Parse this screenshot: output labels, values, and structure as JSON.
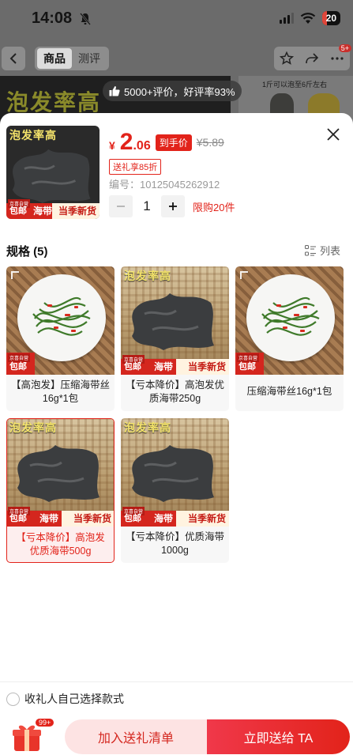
{
  "status_bar": {
    "time": "14:08",
    "battery": "20"
  },
  "nav": {
    "tabs": [
      {
        "label": "商品",
        "active": true
      },
      {
        "label": "测评",
        "active": false
      }
    ],
    "more_badge": "5+"
  },
  "hero": {
    "left_text": "泡发率高",
    "right_text": "1斤可以泡至6斤左右"
  },
  "reviews_pill": "5000+评价，好评率93%",
  "product": {
    "thumb_title": "泡发率高",
    "price_symbol": "¥",
    "price_int": "2",
    "price_dec": ".06",
    "price_tag": "到手价",
    "price_original": "¥5.89",
    "gift_discount": "送礼享85折",
    "sku_label": "编号：10125045262912",
    "quantity": "1",
    "limit_text": "限购20件"
  },
  "image_text": {
    "title": "泡发率高",
    "mall": "京喜自营",
    "free": "包邮",
    "kelp": "海带",
    "fresh": "当季新货"
  },
  "specs": {
    "header": "规格 (5)",
    "list_label": "列表",
    "items": [
      {
        "label": "【高泡发】压缩海带丝16g*1包",
        "image": "salad",
        "selected": false
      },
      {
        "label": "【亏本降价】高泡发优质海带250g",
        "image": "kelp",
        "selected": false
      },
      {
        "label": "压缩海带丝16g*1包",
        "image": "salad",
        "selected": false
      },
      {
        "label": "【亏本降价】高泡发优质海带500g",
        "image": "kelp",
        "selected": true
      },
      {
        "label": "【亏本降价】优质海带1000g",
        "image": "kelp",
        "selected": false
      }
    ]
  },
  "bottom": {
    "recipient_label": "收礼人自己选择款式",
    "gift_badge": "99+",
    "add_list_label": "加入送礼清单",
    "send_label": "立即送给 TA"
  },
  "colors": {
    "accent": "#e2231a",
    "selected_bg": "#fdeeee"
  }
}
